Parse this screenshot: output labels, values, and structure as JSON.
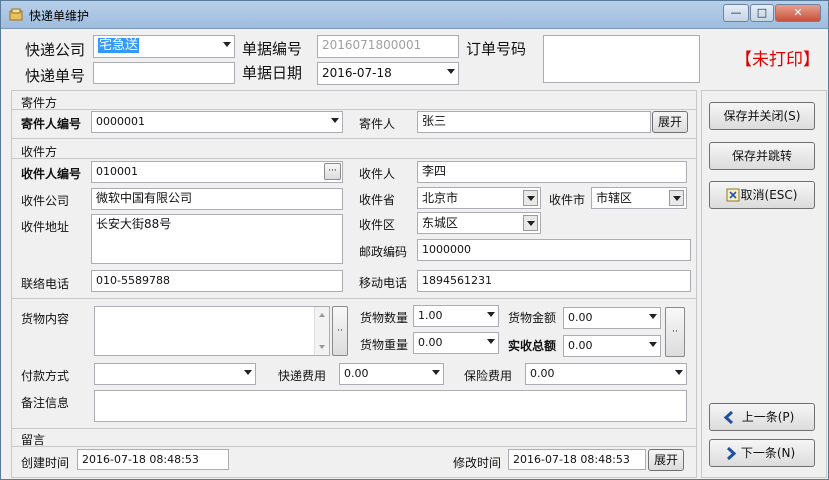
{
  "window": {
    "title": "快递单维护",
    "minimize": "—",
    "maximize": "□",
    "close": "✕"
  },
  "header": {
    "express_company_label": "快递公司",
    "express_company_value": "宅急送",
    "express_number_label": "快递单号",
    "express_number_value": "",
    "doc_number_label": "单据编号",
    "doc_number_value": "2016071800001",
    "doc_date_label": "单据日期",
    "doc_date_value": "2016-07-18",
    "order_number_label": "订单号码",
    "order_number_value": "",
    "print_status": "【未打印】"
  },
  "sender": {
    "section_label": "寄件方",
    "sender_id_label": "寄件人编号",
    "sender_id_value": "0000001",
    "sender_label": "寄件人",
    "sender_value": "张三",
    "expand_button": "展开"
  },
  "receiver": {
    "section_label": "收件方",
    "receiver_id_label": "收件人编号",
    "receiver_id_value": "010001",
    "ellipsis": "···",
    "receiver_label": "收件人",
    "receiver_value": "李四",
    "company_label": "收件公司",
    "company_value": "微软中国有限公司",
    "province_label": "收件省",
    "province_value": "北京市",
    "city_label": "收件市",
    "city_value": "市辖区",
    "address_label": "收件地址",
    "address_value": "长安大街88号",
    "district_label": "收件区",
    "district_value": "东城区",
    "postcode_label": "邮政编码",
    "postcode_value": "1000000",
    "phone_label": "联络电话",
    "phone_value": "010-5589788",
    "mobile_label": "移动电话",
    "mobile_value": "1894561231"
  },
  "goods": {
    "content_label": "货物内容",
    "content_value": "",
    "qty_label": "货物数量",
    "qty_value": "1.00",
    "weight_label": "货物重量",
    "weight_value": "0.00",
    "amount_label": "货物金额",
    "amount_value": "0.00",
    "total_label": "实收总额",
    "total_value": "0.00",
    "payment_label": "付款方式",
    "payment_value": "",
    "fee_label": "快递费用",
    "fee_value": "0.00",
    "insurance_label": "保险费用",
    "insurance_value": "0.00",
    "remark_label": "备注信息",
    "remark_value": "",
    "dots": "··"
  },
  "footer": {
    "section_label": "留言",
    "created_label": "创建时间",
    "created_value": "2016-07-18 08:48:53",
    "modified_label": "修改时间",
    "modified_value": "2016-07-18 08:48:53",
    "expand_button": "展开"
  },
  "actions": {
    "save_close": "保存并关闭(S)",
    "save_next": "保存并跳转",
    "cancel": "取消(ESC)",
    "prev": "上一条(P)",
    "next": "下一条(N)"
  }
}
